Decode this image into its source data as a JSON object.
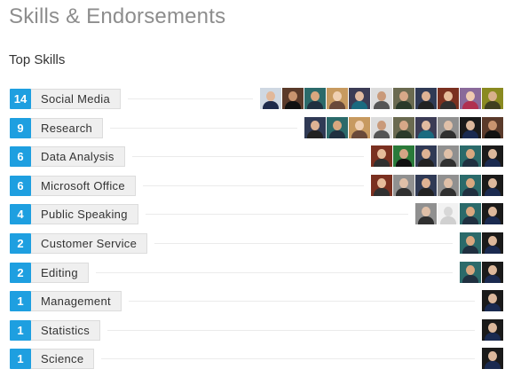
{
  "header": {
    "title": "Skills & Endorsements",
    "subtitle": "Top Skills"
  },
  "skills": [
    {
      "count": "14",
      "name": "Social Media",
      "avatars": [
        "p1",
        "p2",
        "p3",
        "p4",
        "p5",
        "p6",
        "p7",
        "p8",
        "p9",
        "p10",
        "p11"
      ]
    },
    {
      "count": "9",
      "name": "Research",
      "avatars": [
        "p8",
        "p3",
        "p4",
        "p6",
        "p7",
        "p5",
        "p14",
        "p12",
        "p2"
      ]
    },
    {
      "count": "6",
      "name": "Data Analysis",
      "avatars": [
        "p9",
        "p13",
        "p8",
        "p14",
        "p3",
        "p12"
      ]
    },
    {
      "count": "6",
      "name": "Microsoft Office",
      "avatars": [
        "p9",
        "p14",
        "p8",
        "p14",
        "p3",
        "p12"
      ]
    },
    {
      "count": "4",
      "name": "Public Speaking",
      "avatars": [
        "p14",
        "p15",
        "p3",
        "p12"
      ]
    },
    {
      "count": "2",
      "name": "Customer Service",
      "avatars": [
        "p3",
        "p12"
      ]
    },
    {
      "count": "2",
      "name": "Editing",
      "avatars": [
        "p3",
        "p12"
      ]
    },
    {
      "count": "1",
      "name": "Management",
      "avatars": [
        "p12"
      ]
    },
    {
      "count": "1",
      "name": "Statistics",
      "avatars": [
        "p12"
      ]
    },
    {
      "count": "1",
      "name": "Science",
      "avatars": [
        "p12"
      ]
    }
  ]
}
